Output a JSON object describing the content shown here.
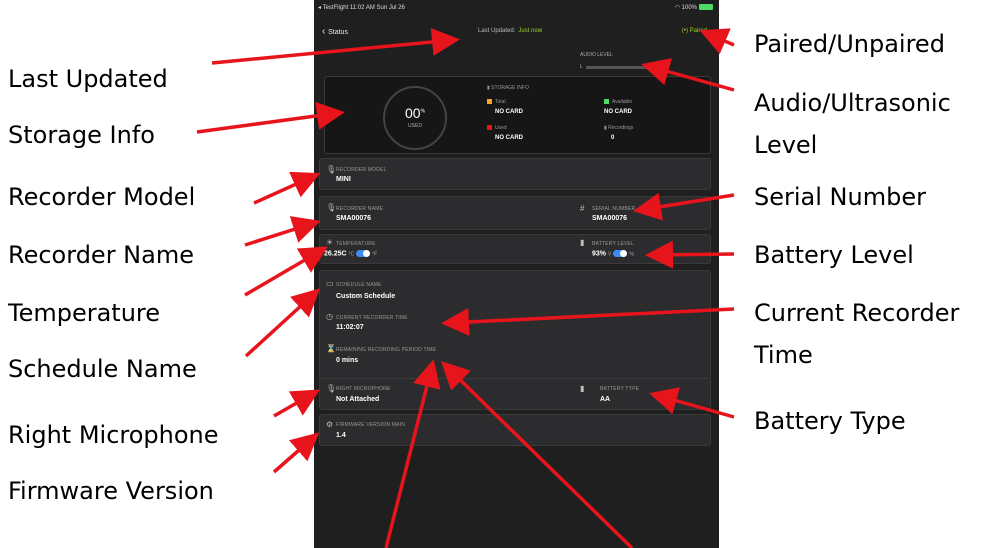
{
  "annotations": {
    "last_updated": "Last Updated",
    "storage_info": "Storage Info",
    "recorder_model": "Recorder Model",
    "recorder_name": "Recorder Name",
    "temperature": "Temperature",
    "schedule_name": "Schedule Name",
    "right_microphone": "Right Microphone",
    "firmware_version": "Firmware Version",
    "paired_unpaired": "Paired/Unpaired",
    "audio_level_1": "Audio/Ultrasonic",
    "audio_level_2": "Level",
    "serial_number": "Serial Number",
    "battery_level": "Battery Level",
    "current_time_1": "Current Recorder",
    "current_time_2": "Time",
    "battery_type": "Battery Type"
  },
  "status_bar": {
    "left": "◂ TestFlight  11:02 AM  Sun Jul 26",
    "right": "100%"
  },
  "nav": {
    "back": "Status",
    "last_updated_label": "Last Updated:",
    "last_updated_value": "Just now",
    "paired": "Paired"
  },
  "audio": {
    "label": "AUDIO LEVEL",
    "channel": "L"
  },
  "storage": {
    "percent": "00",
    "percent_unit": "%",
    "used_label": "USED",
    "header": "STORAGE INFO",
    "total_label": "Total",
    "total_value": "NO CARD",
    "available_label": "Available",
    "available_value": "NO CARD",
    "used_label2": "Used",
    "used_value": "NO CARD",
    "recordings_label": "Recordings",
    "recordings_value": "0"
  },
  "recorder_model": {
    "label": "RECORDER MODEL",
    "value": "MINI"
  },
  "recorder_name": {
    "label": "RECORDER NAME",
    "value": "SMA00076"
  },
  "serial_number": {
    "label": "SERIAL NUMBER",
    "value": "SMA00076"
  },
  "temperature": {
    "label": "TEMPERATURE",
    "value": "26.25C",
    "unit_c": "°C",
    "unit_f": "°F"
  },
  "battery_level": {
    "label": "BATTERY LEVEL",
    "value": "93%",
    "unit_v": "V",
    "unit_pct": "%"
  },
  "schedule": {
    "name_label": "SCHEDULE NAME",
    "name_value": "Custom Schedule",
    "time_label": "CURRENT RECORDER TIME",
    "time_value": "11:02:07",
    "remaining_label": "REMAINING RECORDING PERIOD TIME",
    "remaining_value": "0 mins"
  },
  "right_microphone": {
    "label": "RIGHT MICROPHONE",
    "value": "Not Attached"
  },
  "battery_type": {
    "label": "BATTERY TYPE",
    "value": "AA"
  },
  "firmware": {
    "label": "FIRMWARE VERSION MAIN",
    "value": "1.4"
  },
  "colors": {
    "arrow": "#e8141c",
    "accent": "#9fd22a",
    "toggle": "#3d8cf5"
  }
}
